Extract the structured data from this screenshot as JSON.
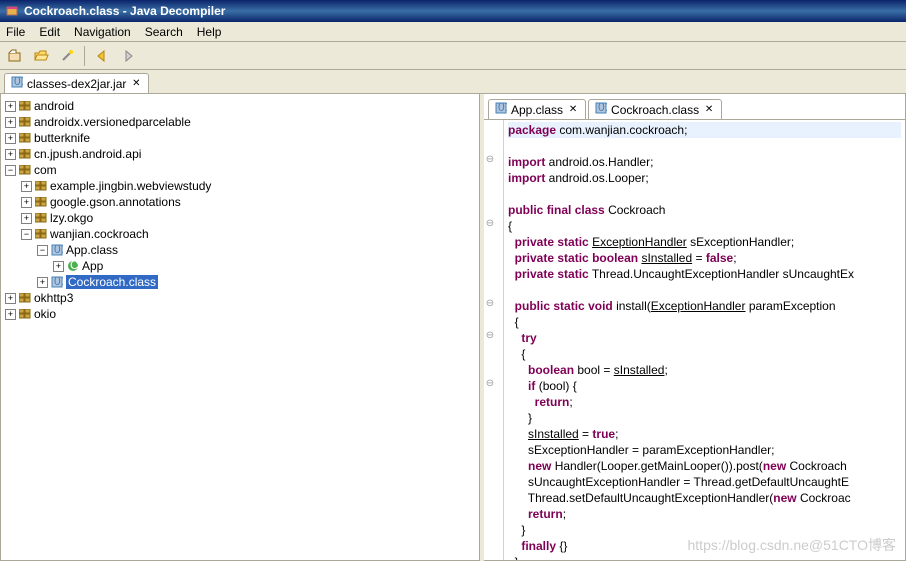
{
  "title": "Cockroach.class - Java Decompiler",
  "menu": {
    "file": "File",
    "edit": "Edit",
    "navigation": "Navigation",
    "search": "Search",
    "help": "Help"
  },
  "jar_tab": "classes-dex2jar.jar",
  "tree": {
    "android": "android",
    "androidx": "androidx.versionedparcelable",
    "butterknife": "butterknife",
    "jpush": "cn.jpush.android.api",
    "com": "com",
    "example": "example.jingbin.webviewstudy",
    "gson": "google.gson.annotations",
    "okgo": "lzy.okgo",
    "wanjian": "wanjian.cockroach",
    "appclass": "App.class",
    "app": "App",
    "cockroach": "Cockroach.class",
    "okhttp3": "okhttp3",
    "okio": "okio"
  },
  "code_tabs": {
    "app": "App.class",
    "cockroach": "Cockroach.class"
  },
  "code": {
    "l1": "package com.wanjian.cockroach;",
    "l3": "import android.os.Handler;",
    "l4": "import android.os.Looper;",
    "l6": "public final class Cockroach",
    "l7": "{",
    "l8": "  private static ExceptionHandler sExceptionHandler;",
    "l9": "  private static boolean sInstalled = false;",
    "l10": "  private static Thread.UncaughtExceptionHandler sUncaughtEx",
    "l12": "  public static void install(ExceptionHandler paramException",
    "l13": "  {",
    "l14": "    try",
    "l15": "    {",
    "l16": "      boolean bool = sInstalled;",
    "l17": "      if (bool) {",
    "l18": "        return;",
    "l19": "      }",
    "l20": "      sInstalled = true;",
    "l21": "      sExceptionHandler = paramExceptionHandler;",
    "l22": "      new Handler(Looper.getMainLooper()).post(new Cockroach",
    "l23": "      sUncaughtExceptionHandler = Thread.getDefaultUncaughtE",
    "l24": "      Thread.setDefaultUncaughtExceptionHandler(new Cockroac",
    "l25": "      return;",
    "l26": "    }",
    "l27": "    finally {}",
    "l28": "  }"
  },
  "watermark": "https://blog.csdn.ne@51CTO博客"
}
